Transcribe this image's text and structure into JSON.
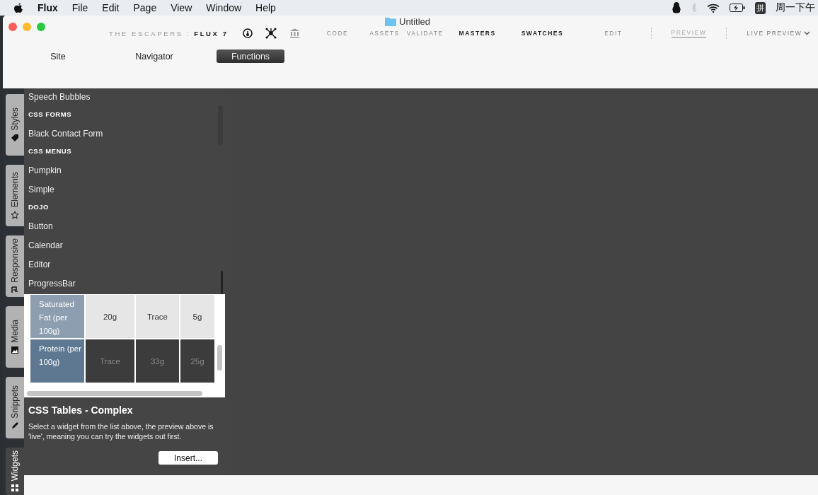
{
  "menu_bar": {
    "app": "Flux",
    "items": [
      "File",
      "Edit",
      "Page",
      "View",
      "Window",
      "Help"
    ],
    "input_method": "拼",
    "clock": "周一下午"
  },
  "window": {
    "title": "Untitled"
  },
  "toolbar": {
    "project": "THE ESCAPERS : ",
    "product": "FLUX 7",
    "items": [
      {
        "label": "CODE",
        "kind": "light",
        "selected": false
      },
      {
        "label": "ASSETS",
        "kind": "light",
        "selected": false
      },
      {
        "label": "VALIDATE",
        "kind": "light",
        "selected": false
      },
      {
        "label": "MASTERS",
        "kind": "bold",
        "selected": false
      },
      {
        "label": "SWATCHES",
        "kind": "bold",
        "selected": false
      },
      {
        "label": "EDIT",
        "kind": "light",
        "selected": false
      },
      {
        "label": "PREVIEW",
        "kind": "light",
        "selected": true
      },
      {
        "label": "LIVE PREVIEW",
        "kind": "dropdown",
        "selected": false
      }
    ]
  },
  "tabs": [
    {
      "label": "Site",
      "selected": false
    },
    {
      "label": "Navigator",
      "selected": false
    },
    {
      "label": "Functions",
      "selected": true
    }
  ],
  "side_tabs": [
    {
      "label": "Styles",
      "selected": false
    },
    {
      "label": "Elements",
      "selected": false
    },
    {
      "label": "Responsive",
      "selected": false
    },
    {
      "label": "Media",
      "selected": false
    },
    {
      "label": "Snippets",
      "selected": false
    },
    {
      "label": "Widgets",
      "selected": true
    }
  ],
  "widget_list": [
    {
      "label": "Speech Bubbles",
      "kind": "item"
    },
    {
      "label": "CSS FORMS",
      "kind": "heading"
    },
    {
      "label": "Black Contact Form",
      "kind": "item"
    },
    {
      "label": "CSS MENUS",
      "kind": "heading"
    },
    {
      "label": "Pumpkin",
      "kind": "item"
    },
    {
      "label": "Simple",
      "kind": "item"
    },
    {
      "label": "DOJO",
      "kind": "heading"
    },
    {
      "label": "Button",
      "kind": "item"
    },
    {
      "label": "Calendar",
      "kind": "item"
    },
    {
      "label": "Editor",
      "kind": "item"
    },
    {
      "label": "ProgressBar",
      "kind": "item"
    }
  ],
  "preview_table": {
    "rows": [
      {
        "header": "Saturated Fat (per 100g)",
        "cells": [
          "20g",
          "Trace",
          "5g"
        ],
        "kind": "light"
      },
      {
        "header": "Protein (per 100g)",
        "cells": [
          "Trace",
          "33g",
          "25g"
        ],
        "kind": "dark"
      }
    ]
  },
  "widget_info": {
    "title": "CSS Tables - Complex",
    "description": "Select a widget from the list above, the preview above is 'live', meaning you can try the widgets out first.",
    "button": "Insert..."
  }
}
